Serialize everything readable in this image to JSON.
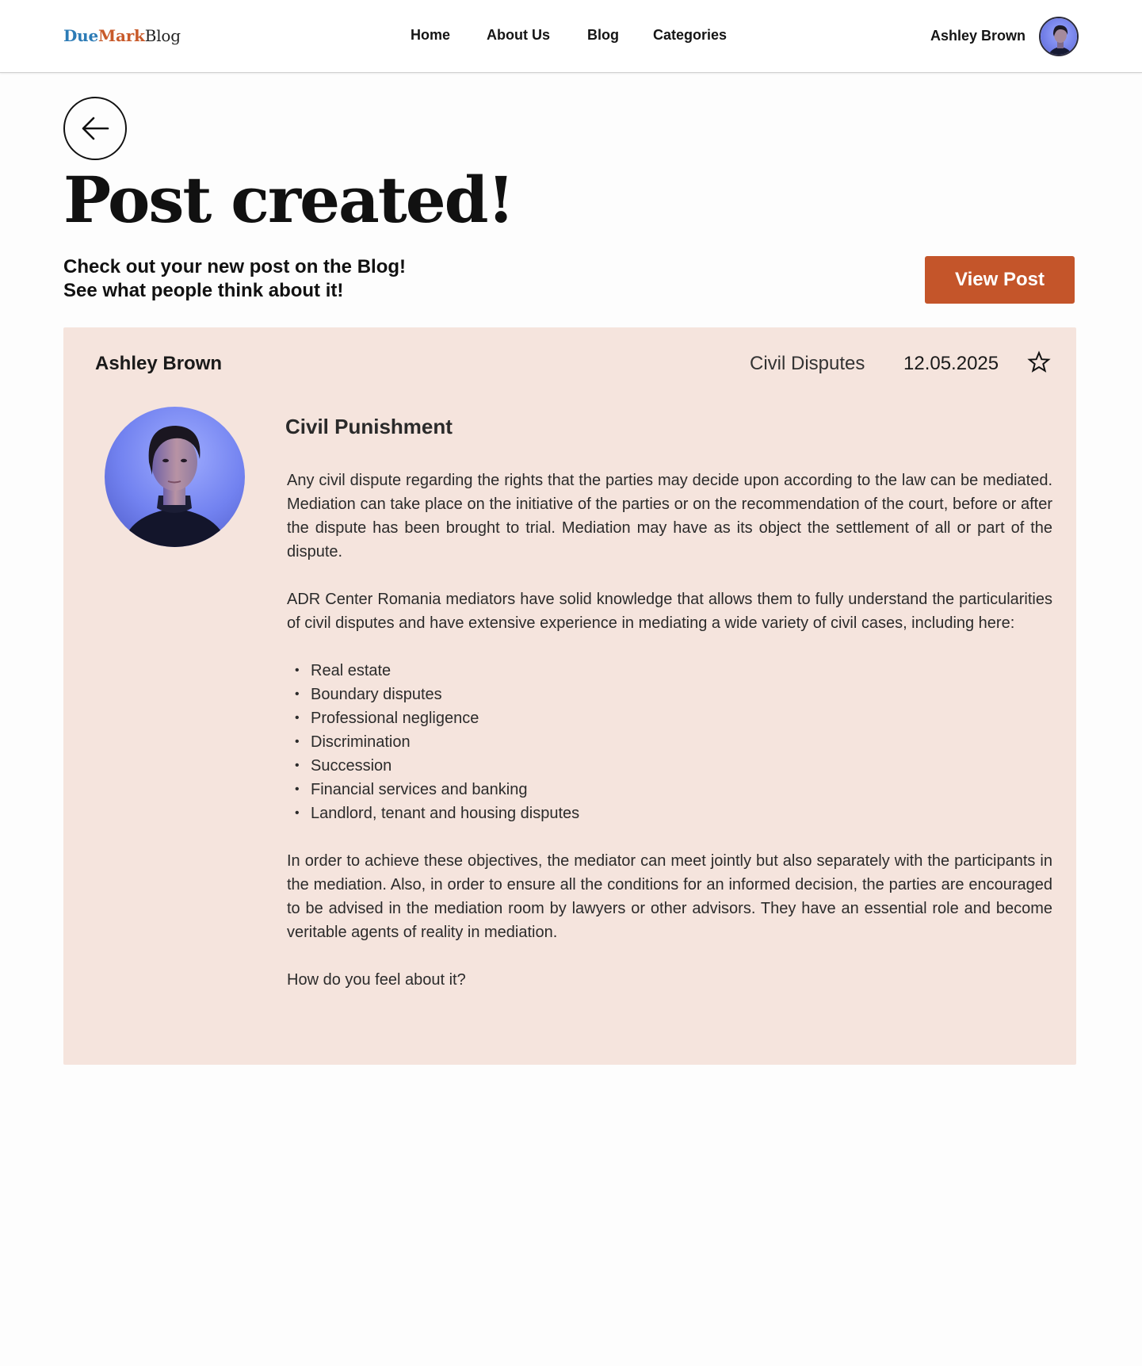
{
  "header": {
    "logo": {
      "part1": "Due",
      "part2": "Mark",
      "part3": "Blog"
    },
    "nav": [
      {
        "label": "Home"
      },
      {
        "label": "About Us"
      },
      {
        "label": "Blog"
      },
      {
        "label": "Categories"
      }
    ],
    "user_name": "Ashley Brown"
  },
  "page": {
    "title": "Post created!",
    "subtitle_line1": "Check out your new post on the Blog!",
    "subtitle_line2": "See what people think about it!",
    "view_post_label": "View Post"
  },
  "post": {
    "author": "Ashley Brown",
    "category": "Civil Disputes",
    "date": "12.05.2025",
    "title": "Civil Punishment",
    "paragraph1": "Any civil dispute regarding the rights that the parties may decide  upon according to the law can be mediated. Mediation can take place on  the initiative of the parties or on the recommendation of the court,  before or after the dispute has been brought to trial. Mediation may  have as its object the settlement of all or part of the dispute.",
    "paragraph2": "ADR Center Romania mediators have solid knowledge that allows them to fully understand the particularities of civil disputes and have extensive  experience in mediating a wide variety of civil cases, including here:",
    "list": [
      "Real estate",
      "Boundary disputes",
      "Professional negligence",
      "Discrimination",
      "Succession",
      "Financial services and banking",
      "Landlord, tenant and housing disputes"
    ],
    "paragraph3": "In order to achieve these objectives, the mediator can meet jointly but  also separately with the participants in the mediation. Also, in order  to ensure all the conditions for an informed decision, the parties are  encouraged to be advised in the mediation room by lawyers or other advisors. They have an essential role and become veritable agents of  reality in mediation.",
    "paragraph4": "How do you feel about it?"
  },
  "icons": {
    "back": "arrow-left-icon",
    "favorite": "star-icon",
    "avatar": "user-avatar"
  },
  "colors": {
    "brand_blue": "#2c7bb6",
    "brand_orange": "#c85a2a",
    "button": "#c4552a",
    "card_background": "#f5e4dd"
  }
}
